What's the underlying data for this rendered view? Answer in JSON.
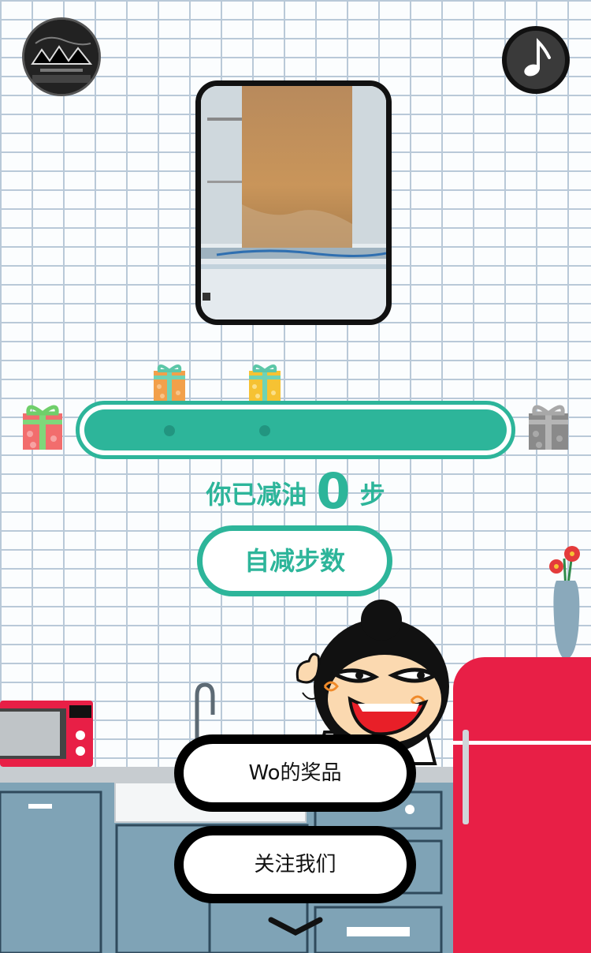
{
  "header": {
    "logo_icon": "mountain-logo-icon",
    "music_icon": "music-note-icon"
  },
  "progress": {
    "fraction": 0,
    "milestones": 2,
    "start_gift_icon": "gift-icon",
    "end_gift_icon": "gift-icon"
  },
  "status": {
    "prefix": "你已减油",
    "count": "0",
    "suffix": "步"
  },
  "buttons": {
    "self_reduce_label": "自减步数",
    "my_prizes_label": "Wo的奖品",
    "follow_us_label": "关注我们"
  },
  "colors": {
    "accent": "#2db59a",
    "fridge": "#e81f46",
    "counter": "#7fa3b6"
  },
  "scroll_hint_icon": "chevron-down-icon"
}
